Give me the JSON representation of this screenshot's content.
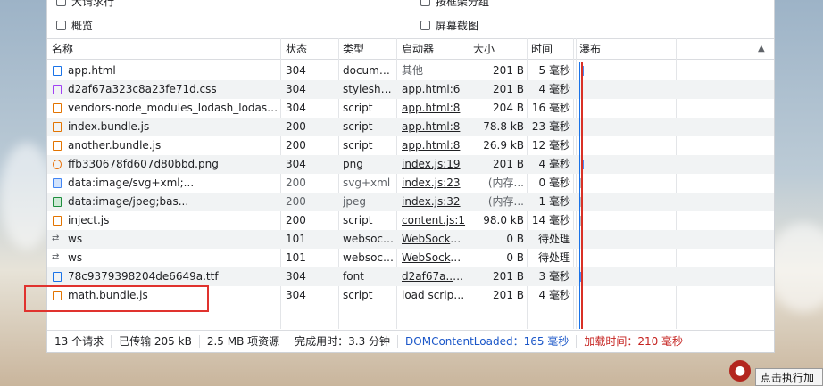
{
  "options": {
    "top_left": "大请求行",
    "top_right": "按框架分组",
    "left": "概览",
    "right": "屏幕截图"
  },
  "columns": {
    "name": "名称",
    "status": "状态",
    "type": "类型",
    "initiator": "启动器",
    "size": "大小",
    "time": "时间",
    "waterfall": "瀑布",
    "sort_icon": "▲"
  },
  "rows": [
    {
      "icon": "doc",
      "name": "app.html",
      "status": "304",
      "type": "document",
      "initiator": "其他",
      "size": "201 B",
      "time": "5 毫秒"
    },
    {
      "icon": "css",
      "name": "d2af67a323c8a23fe71d.css",
      "status": "304",
      "type": "stylesheet",
      "initiator": "app.html:6",
      "size": "201 B",
      "time": "4 毫秒"
    },
    {
      "icon": "js",
      "name": "vendors-node_modules_lodash_lodash_js-...",
      "status": "304",
      "type": "script",
      "initiator": "app.html:8",
      "size": "204 B",
      "time": "16 毫秒"
    },
    {
      "icon": "js",
      "name": "index.bundle.js",
      "status": "200",
      "type": "script",
      "initiator": "app.html:8",
      "size": "78.8 kB",
      "time": "23 毫秒"
    },
    {
      "icon": "js",
      "name": "another.bundle.js",
      "status": "200",
      "type": "script",
      "initiator": "app.html:8",
      "size": "26.9 kB",
      "time": "12 毫秒"
    },
    {
      "icon": "img",
      "name": "ffb330678fd607d80bbd.png",
      "status": "304",
      "type": "png",
      "initiator": "index.js:19",
      "size": "201 B",
      "time": "4 毫秒"
    },
    {
      "icon": "svg",
      "name": "data:image/svg+xml;...",
      "status": "200",
      "type": "svg+xml",
      "initiator": "index.js:23",
      "size": "(内存...",
      "time": "0 毫秒"
    },
    {
      "icon": "jpg",
      "name": "data:image/jpeg;bas...",
      "status": "200",
      "type": "jpeg",
      "initiator": "index.js:32",
      "size": "(内存...",
      "time": "1 毫秒"
    },
    {
      "icon": "js",
      "name": "inject.js",
      "status": "200",
      "type": "script",
      "initiator": "content.js:1",
      "size": "98.0 kB",
      "time": "14 毫秒"
    },
    {
      "icon": "ws",
      "name": "ws",
      "status": "101",
      "type": "websocket",
      "initiator": "WebSocket...",
      "size": "0 B",
      "time": "待处理"
    },
    {
      "icon": "ws",
      "name": "ws",
      "status": "101",
      "type": "websocket",
      "initiator": "WebSocket...",
      "size": "0 B",
      "time": "待处理"
    },
    {
      "icon": "font",
      "name": "78c9379398204de6649a.ttf",
      "status": "304",
      "type": "font",
      "initiator": "d2af67a....css",
      "size": "201 B",
      "time": "3 毫秒"
    },
    {
      "icon": "js",
      "name": "math.bundle.js",
      "status": "304",
      "type": "script",
      "initiator": "load script:41",
      "size": "201 B",
      "time": "4 毫秒"
    }
  ],
  "status_bar": {
    "requests": "13 个请求",
    "transferred": "已传输 205 kB",
    "resources": "2.5 MB 项资源",
    "finish": "完成用时：3.3 分钟",
    "dcl": "DOMContentLoaded：165 毫秒",
    "load": "加载时间：210 毫秒"
  },
  "tooltip": "点击执行加",
  "colors": {
    "highlight": "#e0322e",
    "dcl_line": "#1a73e8",
    "load_line": "#d93025"
  }
}
